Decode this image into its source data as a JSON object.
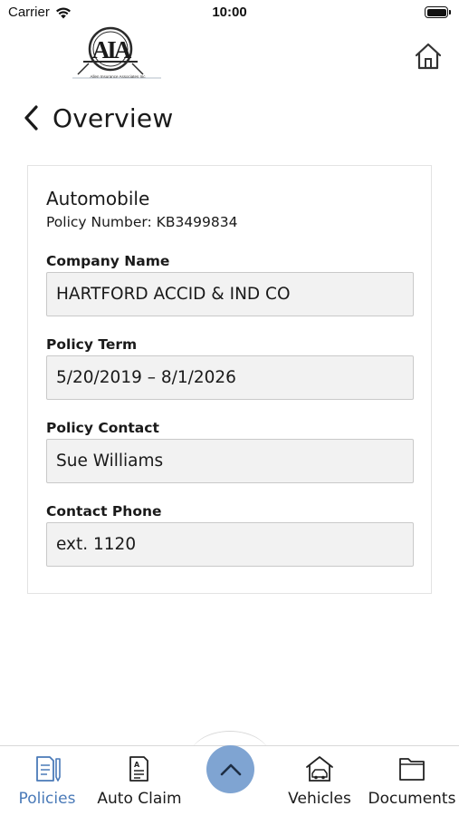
{
  "status_bar": {
    "carrier": "Carrier",
    "time": "10:00"
  },
  "header": {
    "logo_text": "AIA",
    "logo_caption": "Allen Insurance Associates Inc",
    "back_title": "Overview",
    "icons": [
      "wifi-icon",
      "battery-icon",
      "home-icon",
      "chevron-left-icon"
    ]
  },
  "policy": {
    "type": "Automobile",
    "policy_number": "Policy Number: KB3499834",
    "fields": [
      {
        "label": "Company Name",
        "value": "HARTFORD ACCID & IND CO"
      },
      {
        "label": "Policy Term",
        "value": "5/20/2019 – 8/1/2026"
      },
      {
        "label": "Policy Contact",
        "value": "Sue Williams"
      },
      {
        "label": "Contact Phone",
        "value": "ext. 1120"
      }
    ]
  },
  "tab_bar": {
    "tabs": [
      {
        "label": "Policies",
        "icon": "policies-icon",
        "active": true
      },
      {
        "label": "Auto Claim",
        "icon": "auto-claim-icon",
        "active": false
      },
      {
        "label": "Vehicles",
        "icon": "vehicles-icon",
        "active": false
      },
      {
        "label": "Documents",
        "icon": "documents-icon",
        "active": false
      }
    ],
    "center_icon": "chevron-up-icon"
  },
  "colors": {
    "accent": "#4a7ab8",
    "center_button": "#7fa4d2",
    "field_background": "#f2f2f2",
    "field_border": "#c9c9c9"
  }
}
